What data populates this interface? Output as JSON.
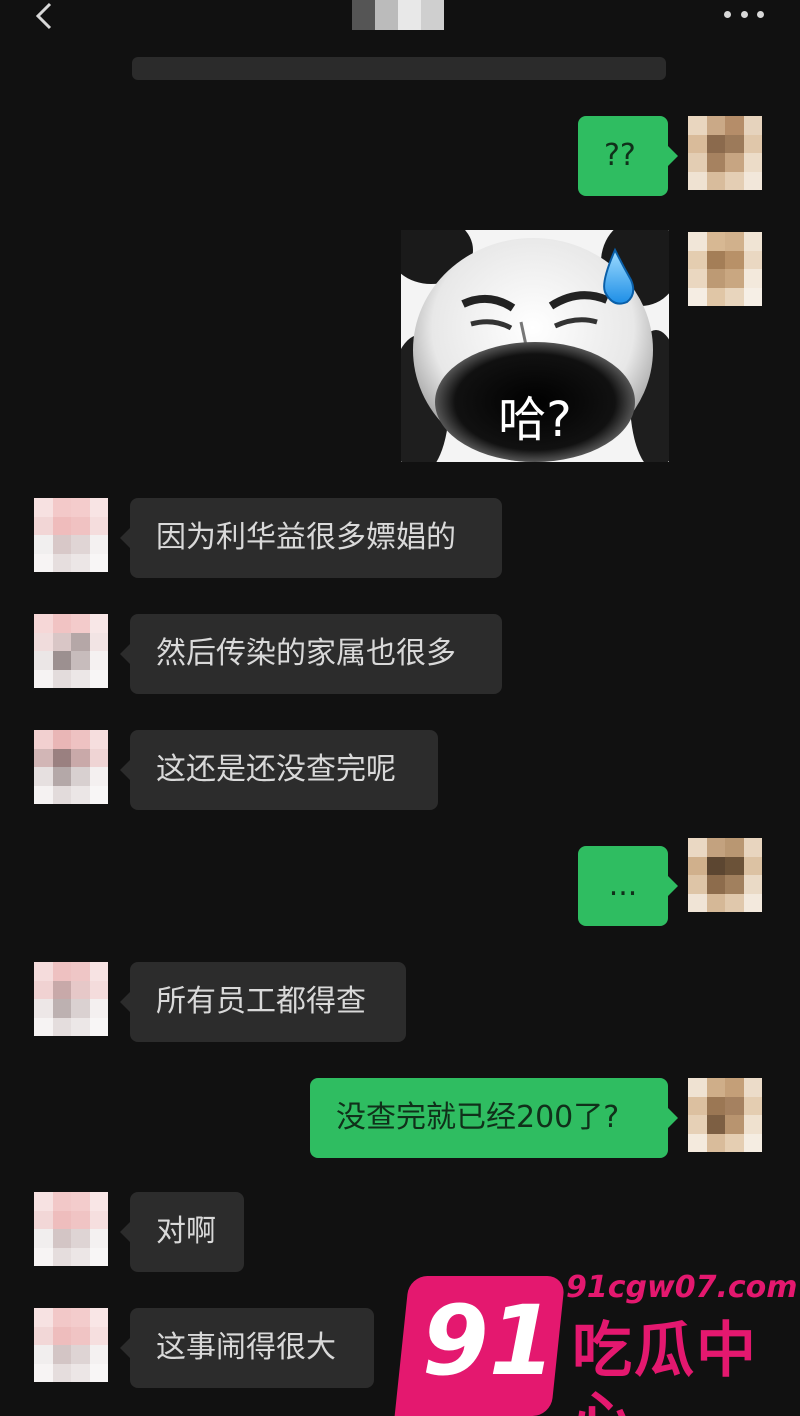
{
  "header": {
    "back_icon": "chevron-left-icon",
    "more_icon": "more-dots-icon"
  },
  "sticker": {
    "caption": "哈?",
    "drop_icon": "sweat-drop-icon"
  },
  "messages": [
    {
      "side": "out",
      "text": "??"
    },
    {
      "side": "out",
      "type": "sticker"
    },
    {
      "side": "in",
      "text": "因为利华益很多嫖娼的"
    },
    {
      "side": "in",
      "text": "然后传染的家属也很多"
    },
    {
      "side": "in",
      "text": "这还是还没查完呢"
    },
    {
      "side": "out",
      "text": "..."
    },
    {
      "side": "in",
      "text": "所有员工都得查"
    },
    {
      "side": "out",
      "text": "没查完就已经200了?"
    },
    {
      "side": "in",
      "text": "对啊"
    },
    {
      "side": "in",
      "text": "这事闹得很大"
    }
  ],
  "watermark": {
    "number": "91",
    "url": "91cgw07.com",
    "name": "吃瓜中心"
  },
  "colors": {
    "background": "#111111",
    "incoming_bubble": "#2c2c2c",
    "outgoing_bubble": "#2fbd61",
    "watermark": "#e4186f"
  }
}
